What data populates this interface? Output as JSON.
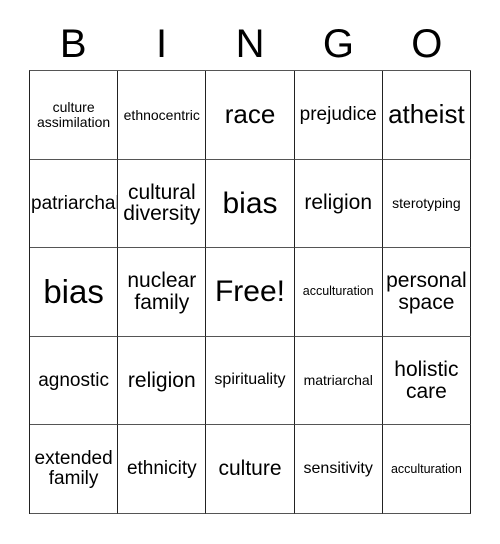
{
  "card": {
    "title_letters": [
      "B",
      "I",
      "N",
      "G",
      "O"
    ],
    "grid_size": "5x5",
    "free_space_label": "Free!",
    "colors": {
      "background": "#ffffff",
      "text": "#000000",
      "grid_line": "#222222"
    },
    "rows": [
      [
        {
          "label": "culture\nassimilation",
          "size": "fs-xs",
          "marked": false
        },
        {
          "label": "ethnocentric",
          "size": "fs-xs",
          "marked": false
        },
        {
          "label": "race",
          "size": "fs-xl",
          "marked": false
        },
        {
          "label": "prejudice",
          "size": "fs-m",
          "marked": false
        },
        {
          "label": "atheist",
          "size": "fs-xl",
          "marked": false
        }
      ],
      [
        {
          "label": "patriarchal",
          "size": "fs-m",
          "marked": false
        },
        {
          "label": "cultural\ndiversity",
          "size": "fs-l",
          "marked": false
        },
        {
          "label": "bias",
          "size": "fs-xxl",
          "marked": false
        },
        {
          "label": "religion",
          "size": "fs-l",
          "marked": false
        },
        {
          "label": "sterotyping",
          "size": "fs-xs",
          "marked": false
        }
      ],
      [
        {
          "label": "bias",
          "size": "fs-huge",
          "marked": false
        },
        {
          "label": "nuclear\nfamily",
          "size": "fs-l",
          "marked": false
        },
        {
          "label": "Free!",
          "size": "fs-xxl",
          "marked": false
        },
        {
          "label": "acculturation",
          "size": "fs-xxs",
          "marked": false
        },
        {
          "label": "personal\nspace",
          "size": "fs-l",
          "marked": false
        }
      ],
      [
        {
          "label": "agnostic",
          "size": "fs-m",
          "marked": false
        },
        {
          "label": "religion",
          "size": "fs-l",
          "marked": false
        },
        {
          "label": "spirituality",
          "size": "fs-s",
          "marked": false
        },
        {
          "label": "matriarchal",
          "size": "fs-xs",
          "marked": false
        },
        {
          "label": "holistic\ncare",
          "size": "fs-l",
          "marked": false
        }
      ],
      [
        {
          "label": "extended\nfamily",
          "size": "fs-m",
          "marked": false
        },
        {
          "label": "ethnicity",
          "size": "fs-m",
          "marked": false
        },
        {
          "label": "culture",
          "size": "fs-l",
          "marked": false
        },
        {
          "label": "sensitivity",
          "size": "fs-s",
          "marked": false
        },
        {
          "label": "acculturation",
          "size": "fs-xxs",
          "marked": false
        }
      ]
    ]
  }
}
